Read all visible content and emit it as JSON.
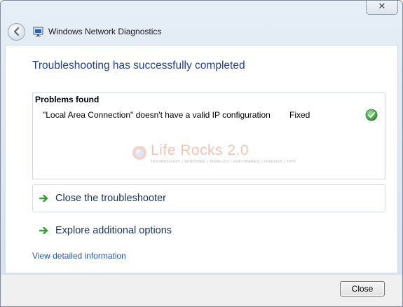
{
  "window": {
    "close_glyph": "✕"
  },
  "header": {
    "title": "Windows Network Diagnostics",
    "back_icon": "back-arrow-icon",
    "app_icon": "network-diagnostics-icon"
  },
  "main": {
    "heading": "Troubleshooting has successfully completed",
    "problems": {
      "title": "Problems found",
      "items": [
        {
          "description": "\"Local Area Connection\" doesn't have a valid IP configuration",
          "status": "Fixed",
          "status_icon": "green-checkmark-icon"
        }
      ]
    },
    "watermark": {
      "title": "Life Rocks 2.0",
      "subtitle": "TECHNOLOGY | WINDOWS | MOBILES | SOFTWARES | FIREFOX | TIPS"
    },
    "options": [
      {
        "label": "Close the troubleshooter",
        "icon": "green-arrow-icon"
      },
      {
        "label": "Explore additional options",
        "icon": "green-arrow-icon"
      }
    ],
    "details_link": "View detailed information"
  },
  "footer": {
    "close_label": "Close"
  },
  "colors": {
    "heading": "#1f3f9a",
    "link": "#1e55b8",
    "arrow_green": "#2ea12e",
    "check_green": "#3ea43e"
  }
}
